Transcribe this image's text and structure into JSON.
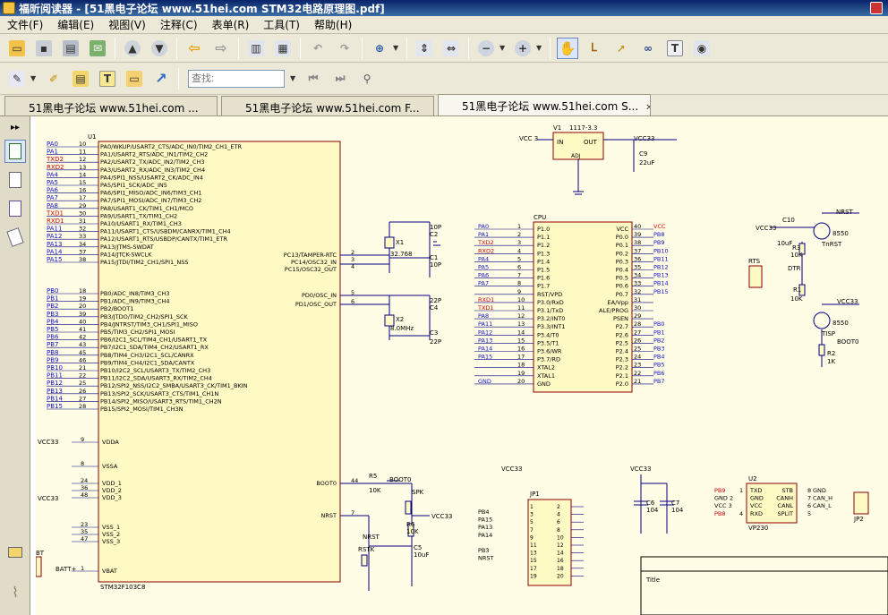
{
  "window": {
    "title": "福昕阅读器 - [51黑电子论坛 www.51hei.com STM32电路原理图.pdf]"
  },
  "menu": [
    "文件(F)",
    "编辑(E)",
    "视图(V)",
    "注释(C)",
    "表单(R)",
    "工具(T)",
    "帮助(H)"
  ],
  "toolbar": {
    "search_placeholder": "查找:"
  },
  "tabs": [
    {
      "label": "51黑电子论坛 www.51hei.com ..."
    },
    {
      "label": "51黑电子论坛 www.51hei.com F..."
    },
    {
      "label": "51黑电子论坛 www.51hei.com S...",
      "close": "✕"
    }
  ],
  "schematic": {
    "u1": {
      "ref": "U1",
      "part": "STM32F103C8",
      "nets_a": [
        "PA0",
        "PA1",
        "TXD2",
        "RXD2",
        "PA4",
        "PA5",
        "PA6",
        "PA7",
        "PA8",
        "TXD1",
        "RXD1",
        "PA11",
        "PA12",
        "PA13",
        "PA14",
        "PA15"
      ],
      "pins_a": [
        "10",
        "11",
        "12",
        "13",
        "14",
        "15",
        "16",
        "17",
        "29",
        "30",
        "31",
        "32",
        "33",
        "34",
        "37",
        "38"
      ],
      "func_a": [
        "PA0/WKUP/USART2_CTS/ADC_IN0/TIM2_CH1_ETR",
        "PA1/USART2_RTS/ADC_IN1/TIM2_CH2",
        "PA2/USART2_TX/ADC_IN2/TIM2_CH3",
        "PA3/USART2_RX/ADC_IN3/TIM2_CH4",
        "PA4/SPI1_NSS/USART2_CK/ADC_IN4",
        "PA5/SPI1_SCK/ADC_IN5",
        "PA6/SPI1_MISO/ADC_IN6/TIM3_CH1",
        "PA7/SPI1_MOSI/ADC_IN7/TIM3_CH2",
        "PA8/USART1_CK/TIM1_CH1/MCO",
        "PA9/USART1_TX/TIM1_CH2",
        "PA10/USART1_RX/TIM1_CH3",
        "PA11/USART1_CTS/USBDM/CANRX/TIM1_CH4",
        "PA12/USART1_RTS/USBDP/CANTX/TIM1_ETR",
        "PA13/JTMS-SWDAT",
        "PA14/JTCK-SWCLK",
        "PA15/JTDI/TIM2_CH1/SPI1_NSS"
      ],
      "nets_b": [
        "PB0",
        "PB1",
        "PB2",
        "PB3",
        "PB4",
        "PB5",
        "PB6",
        "PB7",
        "PB8",
        "PB9",
        "PB10",
        "PB11",
        "PB12",
        "PB13",
        "PB14",
        "PB15"
      ],
      "pins_b": [
        "18",
        "19",
        "20",
        "39",
        "40",
        "41",
        "42",
        "43",
        "45",
        "46",
        "21",
        "22",
        "25",
        "26",
        "27",
        "28"
      ],
      "func_b": [
        "PB0/ADC_IN8/TIM3_CH3",
        "PB1/ADC_IN9/TIM3_CH4",
        "PB2/BOOT1",
        "PB3/JTDO/TIM2_CH2/SPI1_SCK",
        "PB4/JNTRST/TIM3_CH1/SPI1_MISO",
        "PB5/TIM3_CH2/SPI1_MOSI",
        "PB6/I2C1_SCL/TIM4_CH1/USART1_TX",
        "PB7/I2C1_SDA/TIM4_CH2/USART1_RX",
        "PB8/TIM4_CH3/I2C1_SCL/CANRX",
        "PB9/TIM4_CH4/I2C1_SDA/CANTX",
        "PB10/I2C2_SCL/USART3_TX/TIM2_CH3",
        "PB11/I2C2_SDA/USART3_RX/TIM2_CH4",
        "PB12/SPI2_NSS/I2C2_SMBA/USART3_CK/TIM1_BKIN",
        "PB13/SPI2_SCK/USART3_CTS/TIM1_CH1N",
        "PB14/SPI2_MISO/USART3_RTS/TIM1_CH2N",
        "PB15/SPI2_MOSI/TIM1_CH3N"
      ],
      "right_pins": [
        {
          "label": "PC13/TAMPER-RTC",
          "num": "2"
        },
        {
          "label": "PC14/OSC32_IN",
          "num": "3"
        },
        {
          "label": "PC15/OSC32_OUT",
          "num": "4"
        },
        {
          "label": "PD0/OSC_IN",
          "num": "5"
        },
        {
          "label": "PD1/OSC_OUT",
          "num": "6"
        },
        {
          "label": "BOOT0",
          "num": "44"
        },
        {
          "label": "NRST",
          "num": "7"
        }
      ],
      "power_pins": [
        {
          "label": "VDDA",
          "num": "9"
        },
        {
          "label": "VSSA",
          "num": "8"
        },
        {
          "label": "VDD_1",
          "num": "24"
        },
        {
          "label": "VDD_2",
          "num": "36"
        },
        {
          "label": "VDD_3",
          "num": "48"
        },
        {
          "label": "VSS_1",
          "num": "23"
        },
        {
          "label": "VSS_2",
          "num": "35"
        },
        {
          "label": "VSS_3",
          "num": "47"
        },
        {
          "label": "VBAT",
          "num": "1"
        }
      ]
    },
    "labels": {
      "vcc33": "VCC33",
      "vcc3": "VCC 3",
      "vcc": "VCC",
      "gnd": "GND",
      "v1": "V1",
      "v1_part": "1117-3.3",
      "in": "IN",
      "out": "OUT",
      "adj": "ADJ",
      "c9": "C9",
      "c9v": "22uF",
      "x1": "X1",
      "x1v": "32.768",
      "x2": "X2",
      "x2v": "8.0MHz",
      "c1": "C1",
      "c2": "C2",
      "c3": "C3",
      "c4": "C4",
      "c10": "C10",
      "c10v": "10uF",
      "p10": "10P",
      "p22": "22P",
      "r5": "R5",
      "r6": "R6",
      "r2": "R2",
      "r1": "R1",
      "r3": "R3",
      "r4": "R4",
      "k10": "10K",
      "k1": "1K",
      "c5": "C5",
      "c5v": "10uF",
      "c6": "C6",
      "c7": "C7",
      "c104": "104",
      "spk": "SPK",
      "rstk": "RSTK",
      "nrst": "NRST",
      "boot0": "BOOT0",
      "batt": "BATT+",
      "bt": "BT",
      "cpu": "CPU",
      "jp1": "JP1",
      "jp2": "JP2",
      "u2": "U2",
      "vp230": "VP230",
      "rts": "RTS",
      "dtr": "DTR",
      "tnrst": "TnRST",
      "tisp": "TISP",
      "q8550": "8550",
      "title_block": "Title"
    },
    "cpu_left": [
      {
        "net": "PA0",
        "pin": "1",
        "name": "P1.0"
      },
      {
        "net": "PA1",
        "pin": "2",
        "name": "P1.1"
      },
      {
        "net": "TXD2",
        "pin": "3",
        "name": "P1.2"
      },
      {
        "net": "RXD2",
        "pin": "4",
        "name": "P1.3"
      },
      {
        "net": "PA4",
        "pin": "5",
        "name": "P1.4"
      },
      {
        "net": "PA5",
        "pin": "6",
        "name": "P1.5"
      },
      {
        "net": "PA6",
        "pin": "7",
        "name": "P1.6"
      },
      {
        "net": "PA7",
        "pin": "8",
        "name": "P1.7"
      },
      {
        "net": "",
        "pin": "9",
        "name": "RST/VPD"
      },
      {
        "net": "RXD1",
        "pin": "10",
        "name": "P3.0/RxD"
      },
      {
        "net": "TXD1",
        "pin": "11",
        "name": "P3.1/TxD"
      },
      {
        "net": "PA8",
        "pin": "12",
        "name": "P3.2/INT0"
      },
      {
        "net": "PA11",
        "pin": "13",
        "name": "P3.3/INT1"
      },
      {
        "net": "PA12",
        "pin": "14",
        "name": "P3.4/T0"
      },
      {
        "net": "PA13",
        "pin": "15",
        "name": "P3.5/T1"
      },
      {
        "net": "PA14",
        "pin": "16",
        "name": "P3.6/WR"
      },
      {
        "net": "PA15",
        "pin": "17",
        "name": "P3.7/RD"
      },
      {
        "net": "",
        "pin": "18",
        "name": "XTAL2"
      },
      {
        "net": "",
        "pin": "19",
        "name": "XTAL1"
      },
      {
        "net": "GND",
        "pin": "20",
        "name": "GND"
      }
    ],
    "cpu_right": [
      {
        "name": "VCC",
        "pin": "40",
        "net": "VCC"
      },
      {
        "name": "P0.0",
        "pin": "39",
        "net": "PB8"
      },
      {
        "name": "P0.1",
        "pin": "38",
        "net": "PB9"
      },
      {
        "name": "P0.2",
        "pin": "37",
        "net": "PB10"
      },
      {
        "name": "P0.3",
        "pin": "36",
        "net": "PB11"
      },
      {
        "name": "P0.4",
        "pin": "35",
        "net": "PB12"
      },
      {
        "name": "P0.5",
        "pin": "34",
        "net": "PB13"
      },
      {
        "name": "P0.6",
        "pin": "33",
        "net": "PB14"
      },
      {
        "name": "P0.7",
        "pin": "32",
        "net": "PB15"
      },
      {
        "name": "EA/Vpp",
        "pin": "31",
        "net": ""
      },
      {
        "name": "ALE/PROG",
        "pin": "30",
        "net": ""
      },
      {
        "name": "PSEN",
        "pin": "29",
        "net": ""
      },
      {
        "name": "P2.7",
        "pin": "28",
        "net": "PB0"
      },
      {
        "name": "P2.6",
        "pin": "27",
        "net": "PB1"
      },
      {
        "name": "P2.5",
        "pin": "26",
        "net": "PB2"
      },
      {
        "name": "P2.4",
        "pin": "25",
        "net": "PB3"
      },
      {
        "name": "P2.3",
        "pin": "24",
        "net": "PB4"
      },
      {
        "name": "P2.2",
        "pin": "23",
        "net": "PB5"
      },
      {
        "name": "P2.1",
        "pin": "22",
        "net": "PB6"
      },
      {
        "name": "P2.0",
        "pin": "21",
        "net": "PB7"
      }
    ],
    "jp1_nets": [
      "PB4",
      "PA15",
      "PA13",
      "PA14",
      "",
      "PB3",
      "NRST"
    ],
    "u2": {
      "pins_left": [
        {
          "net": "PB9",
          "pin": "1",
          "name": "TXD"
        },
        {
          "net": "GND 2",
          "pin": "",
          "name": "GND"
        },
        {
          "net": "VCC 3",
          "pin": "",
          "name": "VCC"
        },
        {
          "net": "PB8",
          "pin": "4",
          "name": "RXD"
        }
      ],
      "pins_right": [
        {
          "name": "STB",
          "pin": "8",
          "net": "GND"
        },
        {
          "name": "CANH",
          "pin": "7",
          "net": "CAN_H"
        },
        {
          "name": "CANL",
          "pin": "6",
          "net": "CAN_L"
        },
        {
          "name": "SPLIT",
          "pin": "5",
          "net": ""
        }
      ]
    }
  },
  "colors": {
    "net_red": "#cc0000",
    "net_blue": "#1010c8",
    "wire": "#000080",
    "body": "#fff9c4",
    "outline": "#8b0000"
  }
}
